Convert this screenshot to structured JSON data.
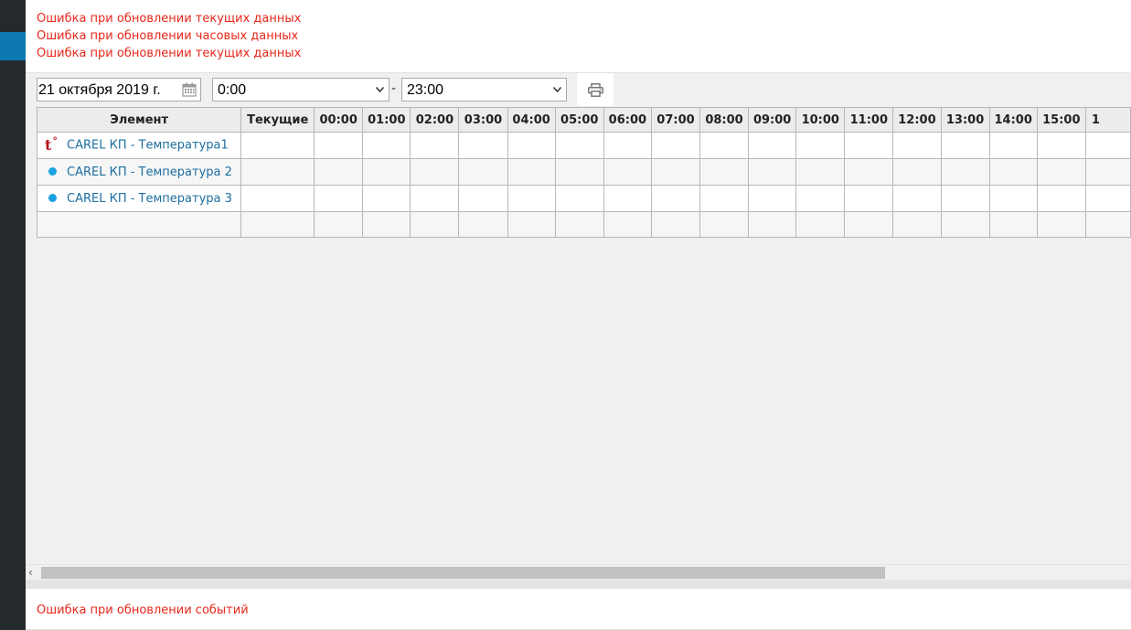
{
  "errors_top": [
    "Ошибка при обновлении текущих данных",
    "Ошибка при обновлении часовых данных",
    "Ошибка при обновлении текущих данных"
  ],
  "toolbar": {
    "date": "21 октября 2019 г.",
    "time_from": "0:00",
    "separator": "-",
    "time_to": "23:00"
  },
  "table": {
    "col_element": "Элемент",
    "col_current": "Текущие",
    "hours": [
      "00:00",
      "01:00",
      "02:00",
      "03:00",
      "04:00",
      "05:00",
      "06:00",
      "07:00",
      "08:00",
      "09:00",
      "10:00",
      "11:00",
      "12:00",
      "13:00",
      "14:00",
      "15:00",
      "1"
    ],
    "rows": [
      {
        "label": "CAREL КП - Температура1",
        "icon": "temperature-icon",
        "icon_text": "t",
        "icon_sup": "°"
      },
      {
        "label": "CAREL КП - Температура 2",
        "icon": "status-dot-icon"
      },
      {
        "label": "CAREL КП - Температура 3",
        "icon": "status-dot-icon"
      }
    ]
  },
  "errors_bottom": "Ошибка при обновлении событий",
  "colors": {
    "error": "#e8271b",
    "link": "#1d6fa0",
    "dot": "#1aa1e1",
    "sidebar": "#23292d",
    "sidebar_active": "#0c79b3"
  }
}
